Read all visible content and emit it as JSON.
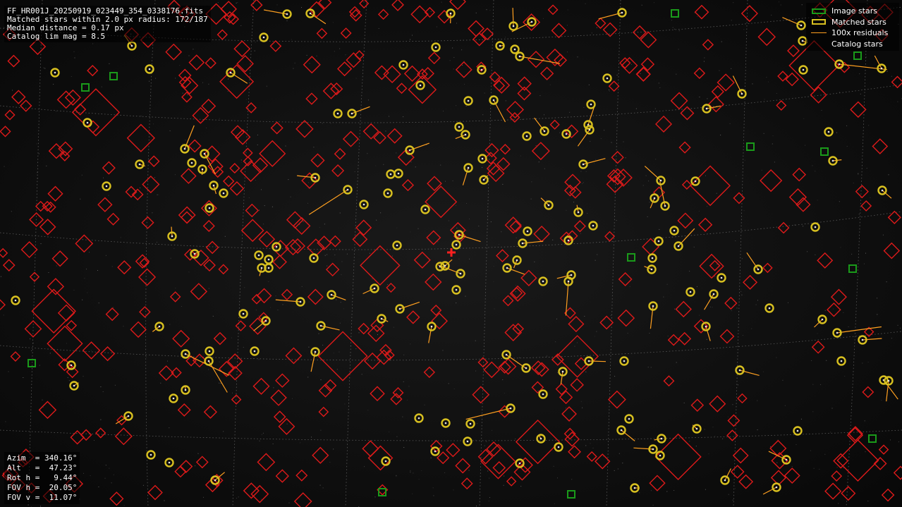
{
  "header": {
    "filename": "FF_HR001J_20250919_023449_354_0338176.fits",
    "matched_line": "Matched stars within 2.0 px radius: 172/187",
    "median_line": "Median distance = 0.17 px",
    "limmag_line": "Catalog lim mag = 8.5"
  },
  "legend": {
    "items": [
      {
        "label": "Image stars",
        "symbol": "box",
        "color": "#1a9a1a"
      },
      {
        "label": "Matched stars",
        "symbol": "box",
        "color": "#d8c020"
      },
      {
        "label": "100x residuals",
        "symbol": "line",
        "color": "#ffa020"
      },
      {
        "label": "Catalog stars",
        "symbol": "none",
        "color": "#dd1a1a"
      }
    ]
  },
  "pointing": {
    "azim": "Azim  = 340.16°",
    "alt": "Alt   =  47.23°",
    "roth": "Rot h =   9.44°",
    "fovh": "FOV h =  20.05°",
    "fovv": "FOV v =  11.07°"
  },
  "colors": {
    "catalog": "#dd1a1a",
    "matched": "#d8c020",
    "image": "#1a9a1a",
    "residual": "#ffa020",
    "grid": "#7a7a7a",
    "center": "#ff2020"
  }
}
